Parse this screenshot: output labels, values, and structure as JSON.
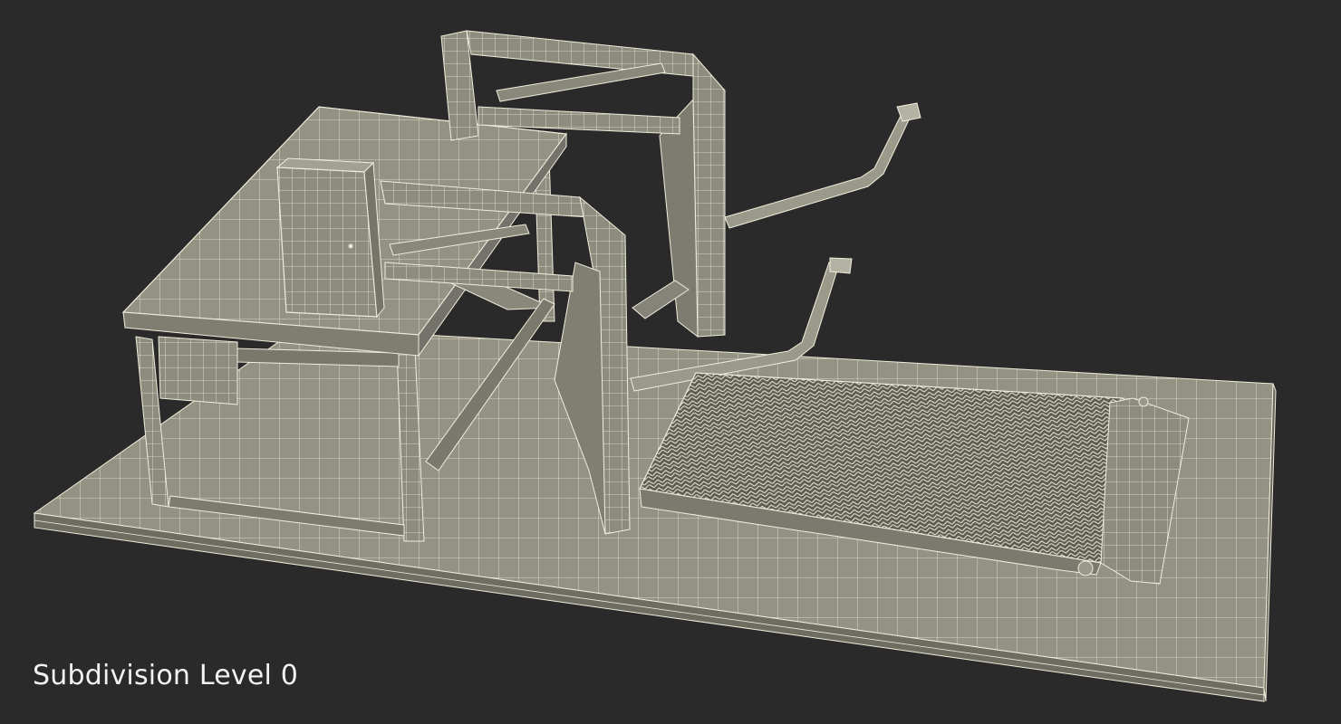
{
  "viewport": {
    "background": "#2a2a2a",
    "caption": "Subdivision Level 0"
  },
  "model": {
    "surface_color": "#8f8d7f",
    "wire_color": "#f0eddc",
    "render_mode": "wireframe-over-shaded"
  }
}
